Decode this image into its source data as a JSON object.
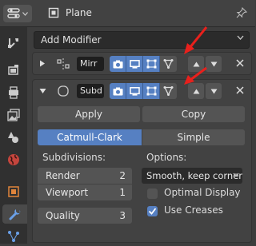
{
  "header": {
    "object_name": "Plane",
    "editor_icon": "properties-editor-icon",
    "object_icon": "mesh-object-icon",
    "pin_icon": "pin-icon"
  },
  "tabs": [
    {
      "name": "tool-tab",
      "icon": "wrench-screwdriver-icon"
    },
    {
      "name": "render-tab",
      "icon": "camera-back-icon"
    },
    {
      "name": "output-tab",
      "icon": "printer-icon"
    },
    {
      "name": "view-layer-tab",
      "icon": "image-stack-icon"
    },
    {
      "name": "scene-tab",
      "icon": "cone-sphere-icon"
    },
    {
      "name": "world-tab",
      "icon": "globe-icon"
    },
    {
      "name": "object-tab",
      "icon": "square-object-icon"
    },
    {
      "name": "modifier-tab",
      "icon": "wrench-icon",
      "active": true
    },
    {
      "name": "particles-tab",
      "icon": "particles-icon"
    }
  ],
  "add_modifier": {
    "label": "Add Modifier"
  },
  "modifiers": [
    {
      "name": "Mirr",
      "type_icon": "mirror-modifier-icon",
      "expanded": false
    },
    {
      "name": "Subd",
      "type_icon": "subsurf-modifier-icon",
      "expanded": true,
      "apply_label": "Apply",
      "copy_label": "Copy",
      "tabs": [
        "Catmull-Clark",
        "Simple"
      ],
      "subdivisions_label": "Subdivisions:",
      "render_label": "Render",
      "render_value": "2",
      "viewport_label": "Viewport",
      "viewport_value": "1",
      "quality_label": "Quality",
      "quality_value": "3",
      "options_label": "Options:",
      "uv_smooth": "Smooth, keep corners",
      "optimal_display_label": "Optimal Display",
      "optimal_display": false,
      "use_creases_label": "Use Creases",
      "use_creases": true
    }
  ],
  "colors": {
    "accent": "#5680c2",
    "annotation_arrow": "#e8201c"
  }
}
